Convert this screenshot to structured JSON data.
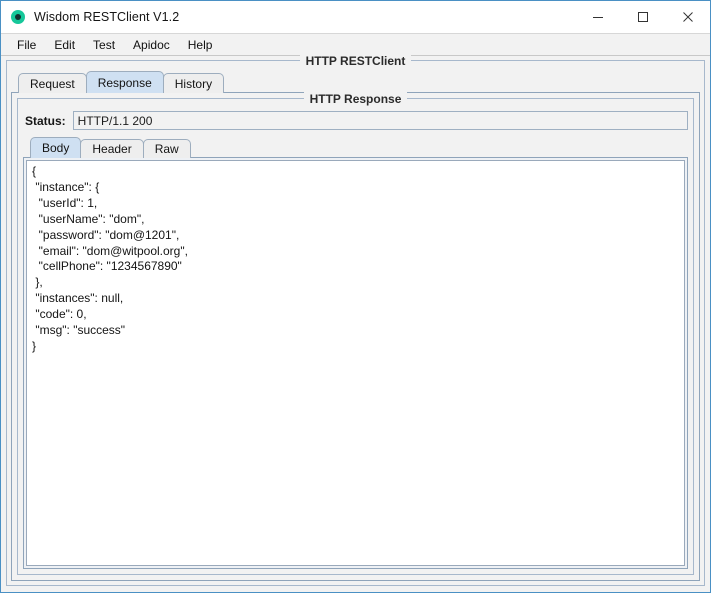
{
  "window": {
    "title": "Wisdom RESTClient V1.2",
    "icon": "app-circle-icon",
    "controls": {
      "minimize": "minimize-icon",
      "maximize": "maximize-icon",
      "close": "close-icon"
    }
  },
  "menubar": {
    "items": [
      {
        "label": "File"
      },
      {
        "label": "Edit"
      },
      {
        "label": "Test"
      },
      {
        "label": "Apidoc"
      },
      {
        "label": "Help"
      }
    ]
  },
  "outer_panel": {
    "legend": "HTTP RESTClient"
  },
  "main_tabs": {
    "items": [
      {
        "label": "Request",
        "selected": false
      },
      {
        "label": "Response",
        "selected": true
      },
      {
        "label": "History",
        "selected": false
      }
    ]
  },
  "response_panel": {
    "legend": "HTTP Response",
    "status": {
      "label": "Status:",
      "value": "HTTP/1.1 200"
    },
    "sub_tabs": {
      "items": [
        {
          "label": "Body",
          "selected": true
        },
        {
          "label": "Header",
          "selected": false
        },
        {
          "label": "Raw",
          "selected": false
        }
      ]
    },
    "body_text": "{\n \"instance\": {\n  \"userId\": 1,\n  \"userName\": \"dom\",\n  \"password\": \"dom@1201\",\n  \"email\": \"dom@witpool.org\",\n  \"cellPhone\": \"1234567890\"\n },\n \"instances\": null,\n \"code\": 0,\n \"msg\": \"success\"\n}"
  },
  "colors": {
    "window_border": "#4a90c4",
    "panel_bg": "#f2f2f2",
    "tab_selected_bg": "#cfe0f2",
    "tab_bg": "#eeeeee",
    "accent_icon": "#16c79a"
  }
}
